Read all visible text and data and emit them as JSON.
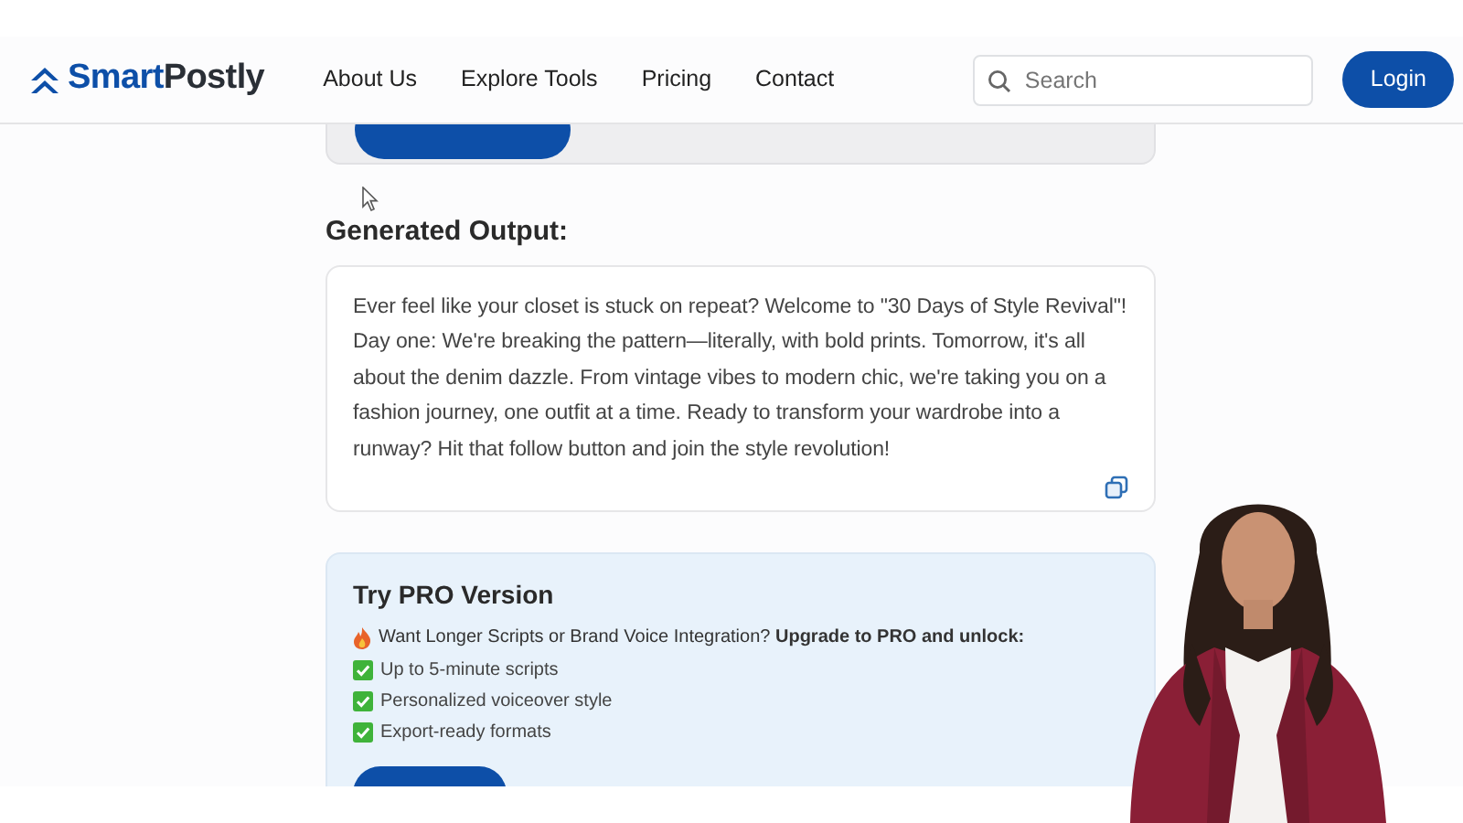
{
  "header": {
    "logo": {
      "first": "Smart",
      "second": "Postly"
    },
    "nav": [
      {
        "label": "About Us"
      },
      {
        "label": "Explore Tools"
      },
      {
        "label": "Pricing"
      },
      {
        "label": "Contact"
      }
    ],
    "search": {
      "placeholder": "Search"
    },
    "login": "Login"
  },
  "output": {
    "heading": "Generated Output:",
    "text": "Ever feel like your closet is stuck on repeat? Welcome to \"30 Days of Style Revival\"! Day one: We're breaking the pattern—literally, with bold prints. Tomorrow, it's all about the denim dazzle. From vintage vibes to modern chic, we're taking you on a fashion journey, one outfit at a time. Ready to transform your wardrobe into a runway? Hit that follow button and join the style revolution!"
  },
  "pro": {
    "title": "Try PRO Version",
    "intro": "Want Longer Scripts or Brand Voice Integration? **Upgrade to PRO and unlock:**",
    "features": [
      {
        "text": "Up to 5-minute scripts"
      },
      {
        "text": "Personalized voiceover style"
      },
      {
        "text": "Export-ready formats"
      }
    ]
  }
}
